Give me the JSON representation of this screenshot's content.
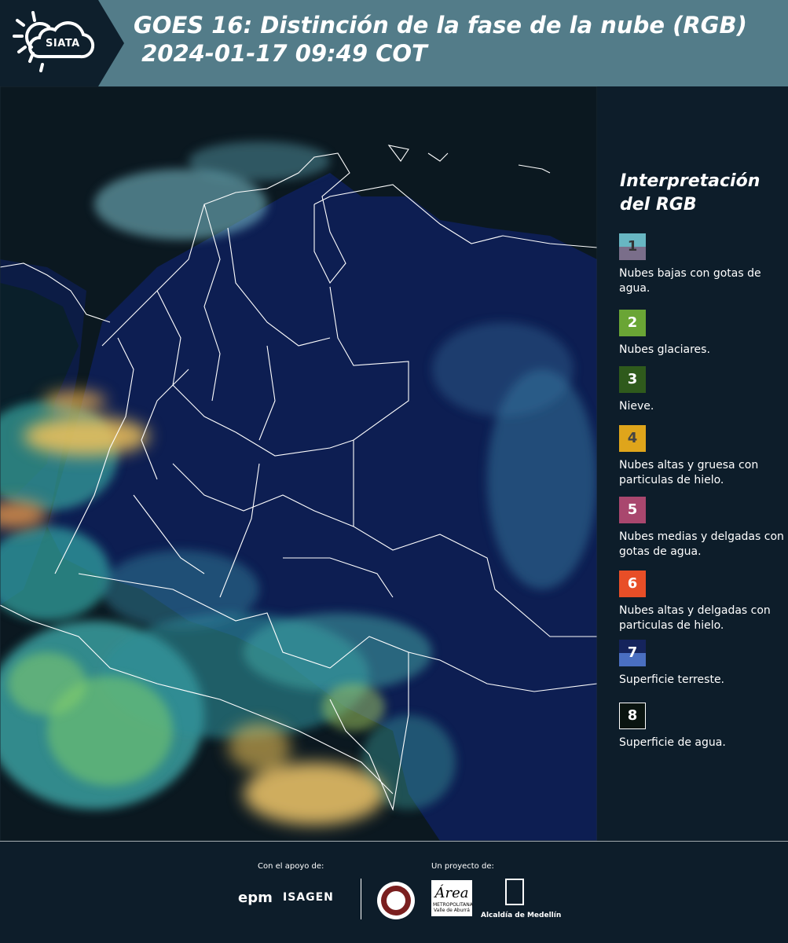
{
  "header": {
    "logo_text": "SIATA",
    "title": "GOES 16: Distinción de la fase de la nube (RGB)\n 2024-01-17 09:49 COT"
  },
  "map": {
    "description_colors": {
      "land": "#0d1e52",
      "water": "#0b1820",
      "low_cloud": "#6fd0c0",
      "thick_ice": "#f0c050",
      "boundary": "#ffffff"
    }
  },
  "legend": {
    "title": "Interpretación del RGB",
    "items": [
      {
        "number": "1",
        "label": "Nubes bajas con gotas de agua.",
        "color_top": "#68b6c2",
        "color_bottom": "#7a6e8a",
        "text_color": "#333333"
      },
      {
        "number": "2",
        "label": "Nubes glaciares.",
        "color_top": "#6aa535",
        "color_bottom": "#6aa535",
        "text_color": "#ffffff"
      },
      {
        "number": "3",
        "label": "Nieve.",
        "color_top": "#2f5a1c",
        "color_bottom": "#2f5a1c",
        "text_color": "#ffffff"
      },
      {
        "number": "4",
        "label": "Nubes altas y gruesa con particulas de hielo.",
        "color_top": "#dfa51b",
        "color_bottom": "#dfa51b",
        "text_color": "#444444"
      },
      {
        "number": "5",
        "label": "Nubes medias y delgadas con gotas de agua.",
        "color_top": "#a9476e",
        "color_bottom": "#a9476e",
        "text_color": "#ffffff"
      },
      {
        "number": "6",
        "label": "Nubes altas y delgadas con particulas de hielo.",
        "color_top": "#e84e27",
        "color_bottom": "#e84e27",
        "text_color": "#ffffff"
      },
      {
        "number": "7",
        "label": "Superficie terreste.",
        "color_top": "#15245c",
        "color_bottom": "#4a6fc1",
        "text_color": "#ffffff"
      },
      {
        "number": "8",
        "label": "Superficie de agua.",
        "color_top": "#0a1410",
        "color_bottom": "#0a1410",
        "text_color": "#ffffff"
      }
    ]
  },
  "footer": {
    "support_label": "Con el apoyo de:",
    "project_label": "Un proyecto de:",
    "epm_text": "epm",
    "isagen_text": "ISAGEN",
    "amva_text": "METROPOLITANA Valle de Aburrá",
    "alcaldia_text": "Alcaldía de Medellín"
  }
}
